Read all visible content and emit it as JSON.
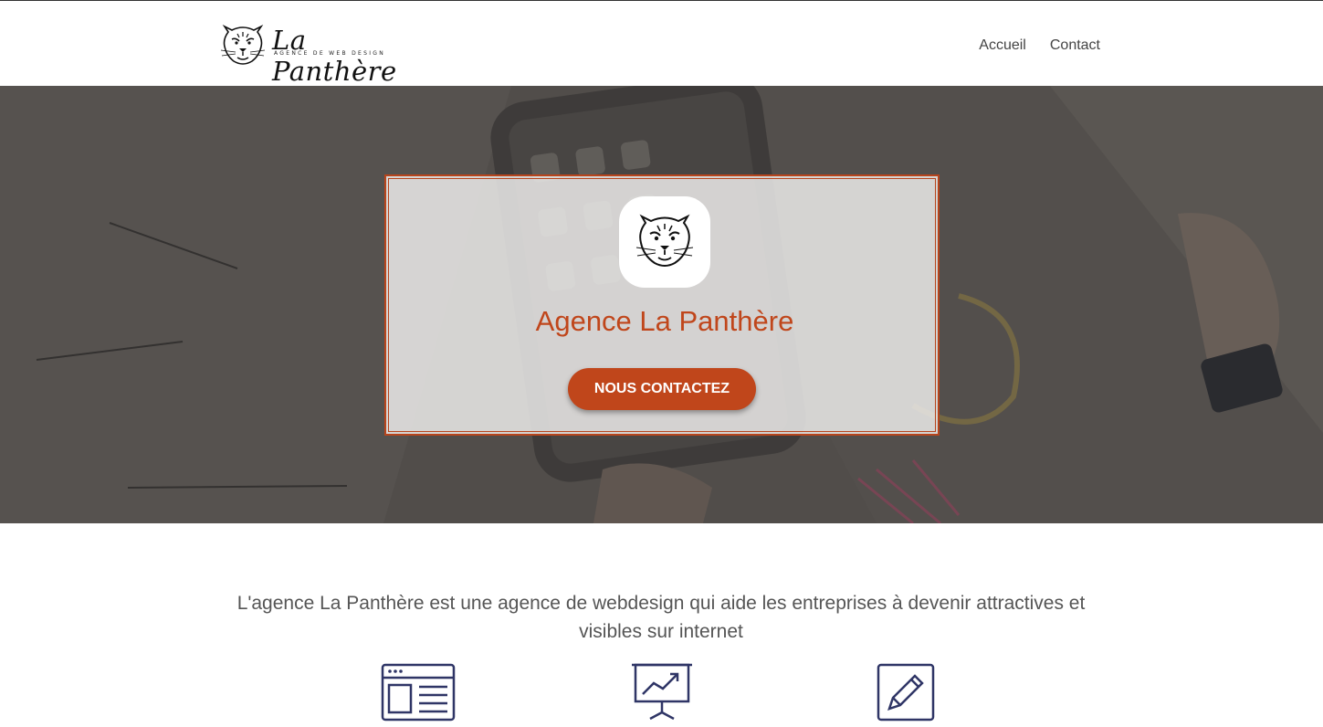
{
  "brand": {
    "title": "La Panthère",
    "subtitle": "AGENCE DE WEB DESIGN",
    "logo_icon": "panther-head-icon"
  },
  "nav": {
    "items": [
      {
        "label": "Accueil"
      },
      {
        "label": "Contact"
      }
    ]
  },
  "hero": {
    "badge_icon": "panther-head-icon",
    "title": "Agence La Panthère",
    "cta_label": "NOUS CONTACTEZ"
  },
  "intro": {
    "text": "L'agence La Panthère est une agence de webdesign qui aide les entreprises à devenir attractives et visibles sur internet"
  },
  "features": [
    {
      "icon": "web-layout-icon"
    },
    {
      "icon": "presentation-chart-icon"
    },
    {
      "icon": "edit-pencil-icon"
    }
  ],
  "colors": {
    "accent": "#c0461b",
    "icon": "#2f3566",
    "text": "#555555"
  }
}
